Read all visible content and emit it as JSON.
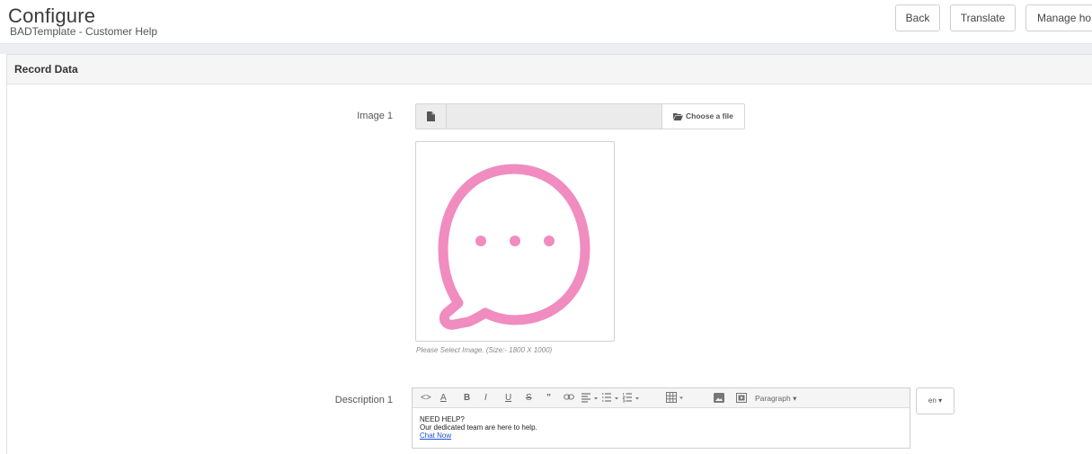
{
  "header": {
    "title": "Configure",
    "subtitle": "BADTemplate - Customer Help",
    "buttons": {
      "back": "Back",
      "translate": "Translate",
      "manage": "Manage ho"
    }
  },
  "panel": {
    "title": "Record Data"
  },
  "image_field": {
    "label": "Image 1",
    "choose_label": "Choose a file",
    "hint": "Please Select Image. (Size:- 1800 X 1000)",
    "preview_icon": "chat-bubble-ellipsis-icon",
    "preview_color": "#f08cbf"
  },
  "description_field": {
    "label": "Description 1",
    "toolbar": {
      "code": "<>",
      "font_color": "A",
      "bold": "B",
      "italic": "I",
      "underline": "U",
      "strikethrough": "S",
      "quote": "”",
      "paragraph": "Paragraph"
    },
    "content": {
      "line1": "NEED HELP?",
      "line2": "Our dedicated team are here to help.",
      "link": "Chat Now"
    },
    "language": "en"
  }
}
